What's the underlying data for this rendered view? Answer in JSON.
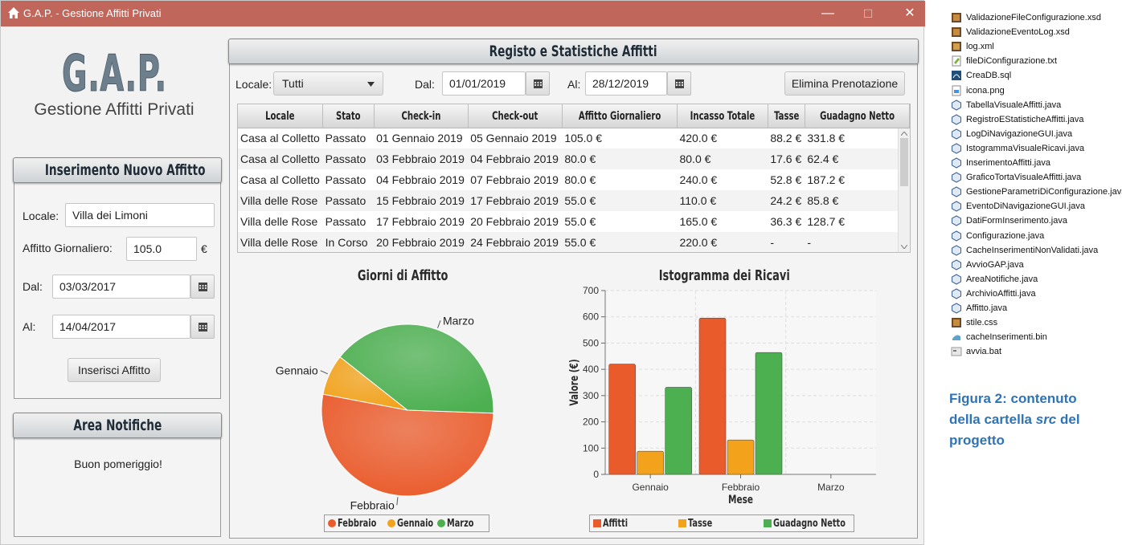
{
  "window": {
    "title": "G.A.P. - Gestione Affitti Privati",
    "minimize": "—",
    "maximize": "☐",
    "close": "✕"
  },
  "logo": {
    "title": "G.A.P.",
    "subtitle": "Gestione Affitti Privati"
  },
  "insert_panel": {
    "header": "Inserimento Nuovo Affitto",
    "locale_label": "Locale:",
    "locale_value": "Villa dei Limoni",
    "affitto_label": "Affitto Giornaliero:",
    "affitto_value": "105.0",
    "currency": "€",
    "dal_label": "Dal:",
    "dal_value": "03/03/2017",
    "al_label": "Al:",
    "al_value": "14/04/2017",
    "submit": "Inserisci Affitto"
  },
  "notifiche_panel": {
    "header": "Area Notifiche",
    "message": "Buon pomeriggio!"
  },
  "registro": {
    "header": "Registo e Statistiche Affitti",
    "locale_label": "Locale:",
    "locale_value": "Tutti",
    "dal_label": "Dal:",
    "dal_value": "01/01/2019",
    "al_label": "Al:",
    "al_value": "28/12/2019",
    "delete_button": "Elimina Prenotazione",
    "columns": [
      "Locale",
      "Stato",
      "Check-in",
      "Check-out",
      "Affitto Giornaliero",
      "Incasso Totale",
      "Tasse",
      "Guadagno Netto"
    ],
    "rows": [
      [
        "Casa al Colletto",
        "Passato",
        "01 Gennaio 2019",
        "05 Gennaio 2019",
        "105.0 €",
        "420.0 €",
        "88.2 €",
        "331.8 €"
      ],
      [
        "Casa al Colletto",
        "Passato",
        "03 Febbraio 2019",
        "04 Febbraio 2019",
        "80.0 €",
        "80.0 €",
        "17.6 €",
        "62.4 €"
      ],
      [
        "Casa al Colletto",
        "Passato",
        "04 Febbraio 2019",
        "07 Febbraio 2019",
        "80.0 €",
        "240.0 €",
        "52.8 €",
        "187.2 €"
      ],
      [
        "Villa delle Rose",
        "Passato",
        "15 Febbraio 2019",
        "17 Febbraio 2019",
        "55.0 €",
        "110.0 €",
        "24.2 €",
        "85.8 €"
      ],
      [
        "Villa delle Rose",
        "Passato",
        "17 Febbraio 2019",
        "20 Febbraio 2019",
        "55.0 €",
        "165.0 €",
        "36.3 €",
        "128.7 €"
      ],
      [
        "Villa delle Rose",
        "In Corso",
        "20 Febbraio 2019",
        "24 Febbraio 2019",
        "55.0 €",
        "220.0 €",
        "-",
        "-"
      ]
    ]
  },
  "chart_data": [
    {
      "type": "pie",
      "title": "Giorni di Affitto",
      "categories": [
        "Febbraio",
        "Gennaio",
        "Marzo"
      ],
      "values": [
        13,
        1.9,
        9.9
      ],
      "colors": [
        "#ea5b2b",
        "#f2a21b",
        "#4caf50"
      ],
      "legend_placement": "bottom"
    },
    {
      "type": "bar",
      "title": "Istogramma dei Ricavi",
      "xlabel": "Mese",
      "ylabel": "Valore (€)",
      "categories": [
        "Gennaio",
        "Febbraio",
        "Marzo"
      ],
      "series": [
        {
          "name": "Affitti",
          "values": [
            420,
            595,
            0
          ],
          "color": "#ea5b2b"
        },
        {
          "name": "Tasse",
          "values": [
            88.2,
            130.9,
            0
          ],
          "color": "#f2a21b"
        },
        {
          "name": "Guadagno Netto",
          "values": [
            331.8,
            464.1,
            0
          ],
          "color": "#4caf50"
        }
      ],
      "ylim": [
        0,
        700
      ],
      "yticks": [
        "0",
        "100",
        "200",
        "300",
        "400",
        "500",
        "600",
        "700"
      ],
      "grid": true,
      "legend_placement": "bottom"
    }
  ],
  "file_tree": {
    "files": [
      {
        "name": "ValidazioneFileConfigurazione.xsd",
        "icon": "xsd-file-icon"
      },
      {
        "name": "ValidazioneEventoLog.xsd",
        "icon": "xsd-file-icon"
      },
      {
        "name": "log.xml",
        "icon": "xml-file-icon"
      },
      {
        "name": "fileDiConfigurazione.txt",
        "icon": "text-file-icon"
      },
      {
        "name": "CreaDB.sql",
        "icon": "sql-file-icon"
      },
      {
        "name": "icona.png",
        "icon": "image-file-icon"
      },
      {
        "name": "TabellaVisualeAffitti.java",
        "icon": "java-file-icon"
      },
      {
        "name": "RegistroEStatisticheAffitti.java",
        "icon": "java-file-icon"
      },
      {
        "name": "LogDiNavigazioneGUI.java",
        "icon": "java-file-icon"
      },
      {
        "name": "IstogrammaVisualeRicavi.java",
        "icon": "java-file-icon"
      },
      {
        "name": "InserimentoAffitti.java",
        "icon": "java-file-icon"
      },
      {
        "name": "GraficoTortaVisualeAffitti.java",
        "icon": "java-file-icon"
      },
      {
        "name": "GestioneParametriDiConfigurazione.java",
        "icon": "java-file-icon"
      },
      {
        "name": "EventoDiNavigazioneGUI.java",
        "icon": "java-file-icon"
      },
      {
        "name": "DatiFormInserimento.java",
        "icon": "java-file-icon"
      },
      {
        "name": "Configurazione.java",
        "icon": "java-file-icon"
      },
      {
        "name": "CacheInserimentiNonValidati.java",
        "icon": "java-file-icon"
      },
      {
        "name": "AvvioGAP.java",
        "icon": "java-file-icon"
      },
      {
        "name": "AreaNotifiche.java",
        "icon": "java-file-icon"
      },
      {
        "name": "ArchivioAffitti.java",
        "icon": "java-file-icon"
      },
      {
        "name": "Affitto.java",
        "icon": "java-file-icon"
      },
      {
        "name": "stile.css",
        "icon": "css-file-icon"
      },
      {
        "name": "cacheInserimenti.bin",
        "icon": "bin-file-icon"
      },
      {
        "name": "avvia.bat",
        "icon": "bat-file-icon"
      }
    ]
  },
  "caption": {
    "prefix": "Figura 2: contenuto della cartella ",
    "emph": "src",
    "suffix": " del progetto"
  }
}
